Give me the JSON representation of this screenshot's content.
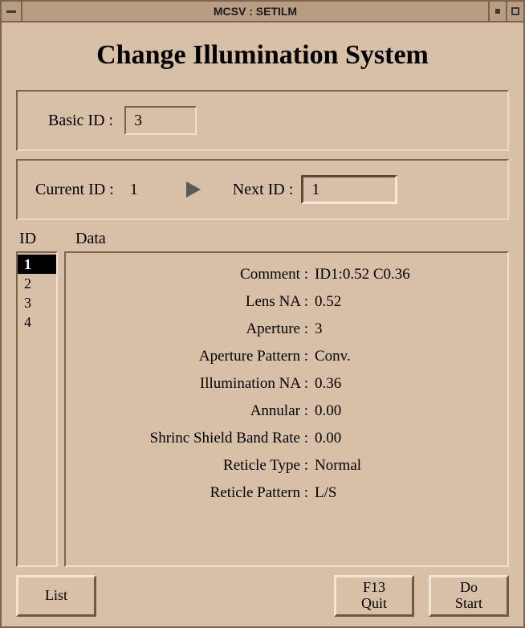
{
  "titlebar": {
    "title": "MCSV : SETILM"
  },
  "page_title": "Change Illumination System",
  "basic": {
    "label": "Basic ID :",
    "value": "3"
  },
  "current": {
    "label": "Current ID :",
    "value": "1",
    "next_label": "Next ID :",
    "next_value": "1"
  },
  "headers": {
    "id": "ID",
    "data": "Data"
  },
  "id_list": [
    "1",
    "2",
    "3",
    "4"
  ],
  "selected_id_index": 0,
  "fields": {
    "comment": {
      "label": "Comment :",
      "value": "ID1:0.52 C0.36"
    },
    "lens_na": {
      "label": "Lens NA :",
      "value": "0.52"
    },
    "aperture": {
      "label": "Aperture :",
      "value": "3"
    },
    "ap_pattern": {
      "label": "Aperture Pattern :",
      "value": "Conv."
    },
    "illum_na": {
      "label": "Illumination NA :",
      "value": "0.36"
    },
    "annular": {
      "label": "Annular :",
      "value": "0.00"
    },
    "shrinc": {
      "label": "Shrinc Shield Band Rate :",
      "value": "0.00"
    },
    "reticle_type": {
      "label": "Reticle Type :",
      "value": "Normal"
    },
    "reticle_patt": {
      "label": "Reticle Pattern :",
      "value": "L/S"
    }
  },
  "buttons": {
    "list": "List",
    "quit": "F13\nQuit",
    "start": "Do\nStart"
  }
}
